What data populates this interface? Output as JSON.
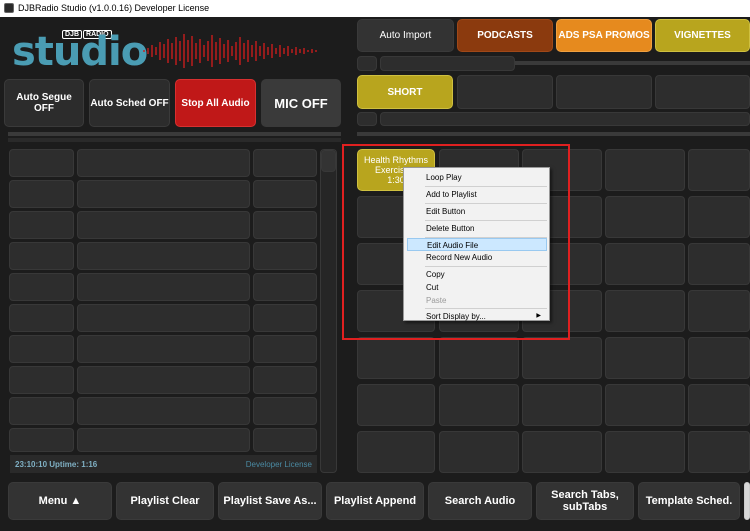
{
  "window": {
    "title": "DJBRadio Studio (v1.0.0.16) Developer License"
  },
  "logo": {
    "brand": "DJB",
    "brand_badge": "RADIO",
    "product": "studio"
  },
  "colors": {
    "accent": "#4a9cb3",
    "podcasts": "#8b3a0e",
    "ads": "#e68a1e",
    "vignettes": "#b8a51e",
    "short": "#b8a51e",
    "stop": "#c01818",
    "waveform": "#c81e1e"
  },
  "controls": {
    "auto_segue": "Auto Segue OFF",
    "auto_sched": "Auto Sched OFF",
    "stop_all": "Stop All Audio",
    "mic": "MIC OFF"
  },
  "top_buttons": {
    "auto_import": "Auto Import",
    "podcasts": "PODCASTS",
    "ads": "ADS PSA PROMOS",
    "vignettes": "VIGNETTES",
    "short": "SHORT"
  },
  "cart": {
    "line1": "Health Rhythms",
    "line2": "Exercise a",
    "line3": "1:30"
  },
  "context_menu": {
    "items": [
      "Loop Play",
      "Add to Playlist",
      "Edit Button",
      "Delete Button",
      "Edit Audio File",
      "Record New Audio",
      "Copy",
      "Cut",
      "Paste",
      "Sort Display by..."
    ],
    "highlighted": "Edit Audio File",
    "disabled": "Paste"
  },
  "status": {
    "clock": "23:10:10 Uptime: 1:16",
    "license": "Developer License"
  },
  "bottom": [
    "Menu ▲",
    "Playlist Clear",
    "Playlist Save As...",
    "Playlist Append",
    "Search Audio",
    "Search Tabs, subTabs",
    "Template Sched."
  ]
}
